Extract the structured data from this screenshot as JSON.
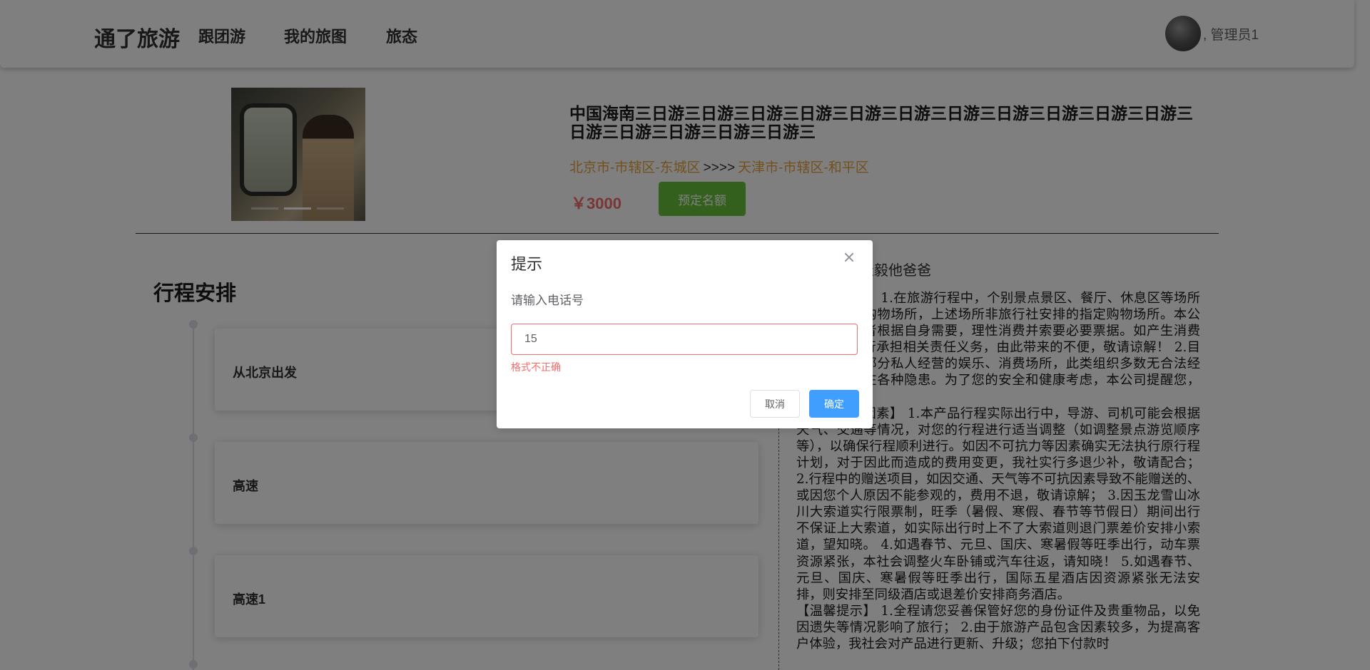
{
  "header": {
    "logo": "通了旅游",
    "nav": [
      "跟团游",
      "我的旅图",
      "旅态"
    ],
    "user_name": ", 管理员1"
  },
  "product": {
    "title": "中国海南三日游三日游三日游三日游三日游三日游三日游三日游三日游三日游三日游三日游三日游三日游三日游三日游三",
    "from": "北京市-市辖区-东城区",
    "arrows": ">>>>",
    "to": "天津市-市辖区-和平区",
    "price": "￥3000",
    "book_label": "预定名额"
  },
  "itinerary": {
    "title": "行程安排",
    "items": [
      "从北京出发",
      "高速",
      "高速1"
    ]
  },
  "notes": {
    "author": "佳毅他爸爸",
    "text": "【购物场所】 1.在旅游行程中，个别景点景区、餐厅、休息区等场所存在商场等购物场所，上述场所非旅行社安排的指定购物场所。本公司提醒旅游者根据自身需要，理性消费并索要必要票据。如产生消费争议，请自行承担相关责任义务，由此带来的不便，敬请谅解！ 2.目的地可能有部分私人经营的娱乐、消费场所，此类组织多数无合法经营资质，存在各种隐患。为了您的安全和健康考虑，本公司提醒您，谨慎消费；\n【不可抗力因素】 1.本产品行程实际出行中，导游、司机可能会根据天气、交通等情况，对您的行程进行适当调整（如调整景点游览顺序等），以确保行程顺利进行。如因不可抗力等因素确实无法执行原行程计划，对于因此而造成的费用变更，我社实行多退少补，敬请配合； 2.行程中的赠送项目，如因交通、天气等不可抗因素导致不能赠送的、或因您个人原因不能参观的，费用不退，敬请谅解； 3.因玉龙雪山冰川大索道实行限票制，旺季（暑假、寒假、春节等节假日）期间出行不保证上大索道，如实际出行时上不了大索道则退门票差价安排小索道，望知晓。 4.如遇春节、元旦、国庆、寒暑假等旺季出行，动车票资源紧张，本社会调整火车卧铺或汽车往返，请知晓！ 5.如遇春节、元旦、国庆、寒暑假等旺季出行，国际五星酒店因资源紧张无法安排，则安排至同级酒店或退差价安排商务酒店。\n【温馨提示】 1.全程请您妥善保管好您的身份证件及贵重物品，以免因遗失等情况影响了旅行； 2.由于旅游产品包含因素较多，为提高客户体验，我社会对产品进行更新、升级；您拍下付款时"
  },
  "dialog": {
    "title": "提示",
    "message": "请输入电话号",
    "input_value": "15",
    "error": "格式不正确",
    "cancel": "取消",
    "confirm": "确定"
  }
}
